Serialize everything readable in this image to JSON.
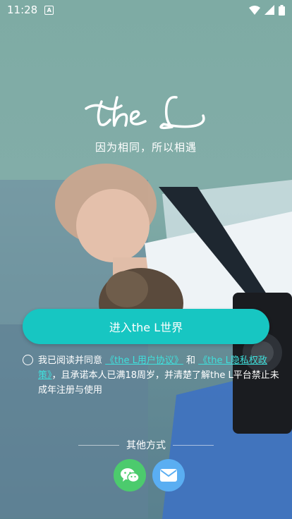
{
  "status_bar": {
    "time": "11:28"
  },
  "tagline": "因为相同，所以相遇",
  "enter_button": "进入the L世界",
  "agreement": {
    "prefix": "我已阅读并同意 ",
    "user_agreement": "《the L用户协议》",
    "and": " 和 ",
    "privacy_policy": "《the L隐私权政策》",
    "suffix": "，且承诺本人已满18周岁，并清楚了解the L平台禁止未成年注册与使用"
  },
  "other_methods_label": "其他方式",
  "colors": {
    "accent": "#17c6c2",
    "wechat": "#4ccb6d",
    "email": "#5aaef2"
  }
}
